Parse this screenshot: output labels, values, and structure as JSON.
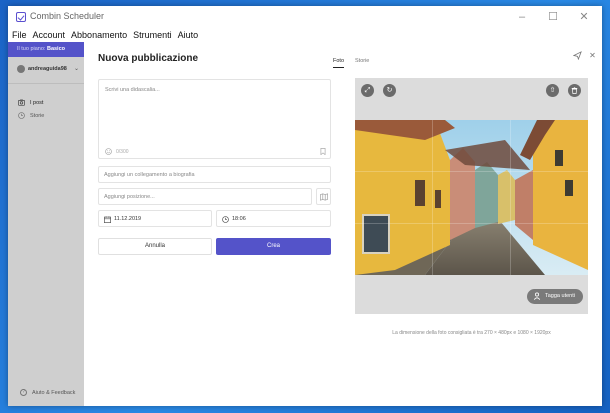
{
  "window": {
    "title": "Combin Scheduler",
    "controls": [
      "–",
      "☐",
      "✕"
    ]
  },
  "menu": [
    "File",
    "Account",
    "Abbonamento",
    "Strumenti",
    "Aiuto"
  ],
  "sidebar": {
    "plan_prefix": "Il tuo piano:",
    "plan_name": "Basico",
    "account_name": "andreaguida98",
    "items": [
      {
        "label": "I post",
        "icon": "camera-icon",
        "active": true
      },
      {
        "label": "Storie",
        "icon": "clock-icon",
        "active": false
      }
    ],
    "help_label": "Aiuto & Feedback"
  },
  "modal": {
    "title": "Nuova pubblicazione",
    "tabs": [
      {
        "label": "Foto",
        "active": true
      },
      {
        "label": "Storie",
        "active": false
      }
    ],
    "caption_placeholder": "Scrivi una didascalia...",
    "char_count": "0/300",
    "link_placeholder": "Aggiungi un collegamento a biografia",
    "location_placeholder": "Aggiungi posizione...",
    "date": "11.12.2019",
    "time": "18:06",
    "cancel_label": "Annulla",
    "create_label": "Crea"
  },
  "preview": {
    "tag_label": "Tagga utenti",
    "hint": "La dimensione della foto consigliata è tra 270 × 480px e 1080 × 1920px"
  },
  "colors": {
    "accent": "#5453c9",
    "sidebar": "#cfcfcf",
    "desktop": "#1d6fd0"
  }
}
